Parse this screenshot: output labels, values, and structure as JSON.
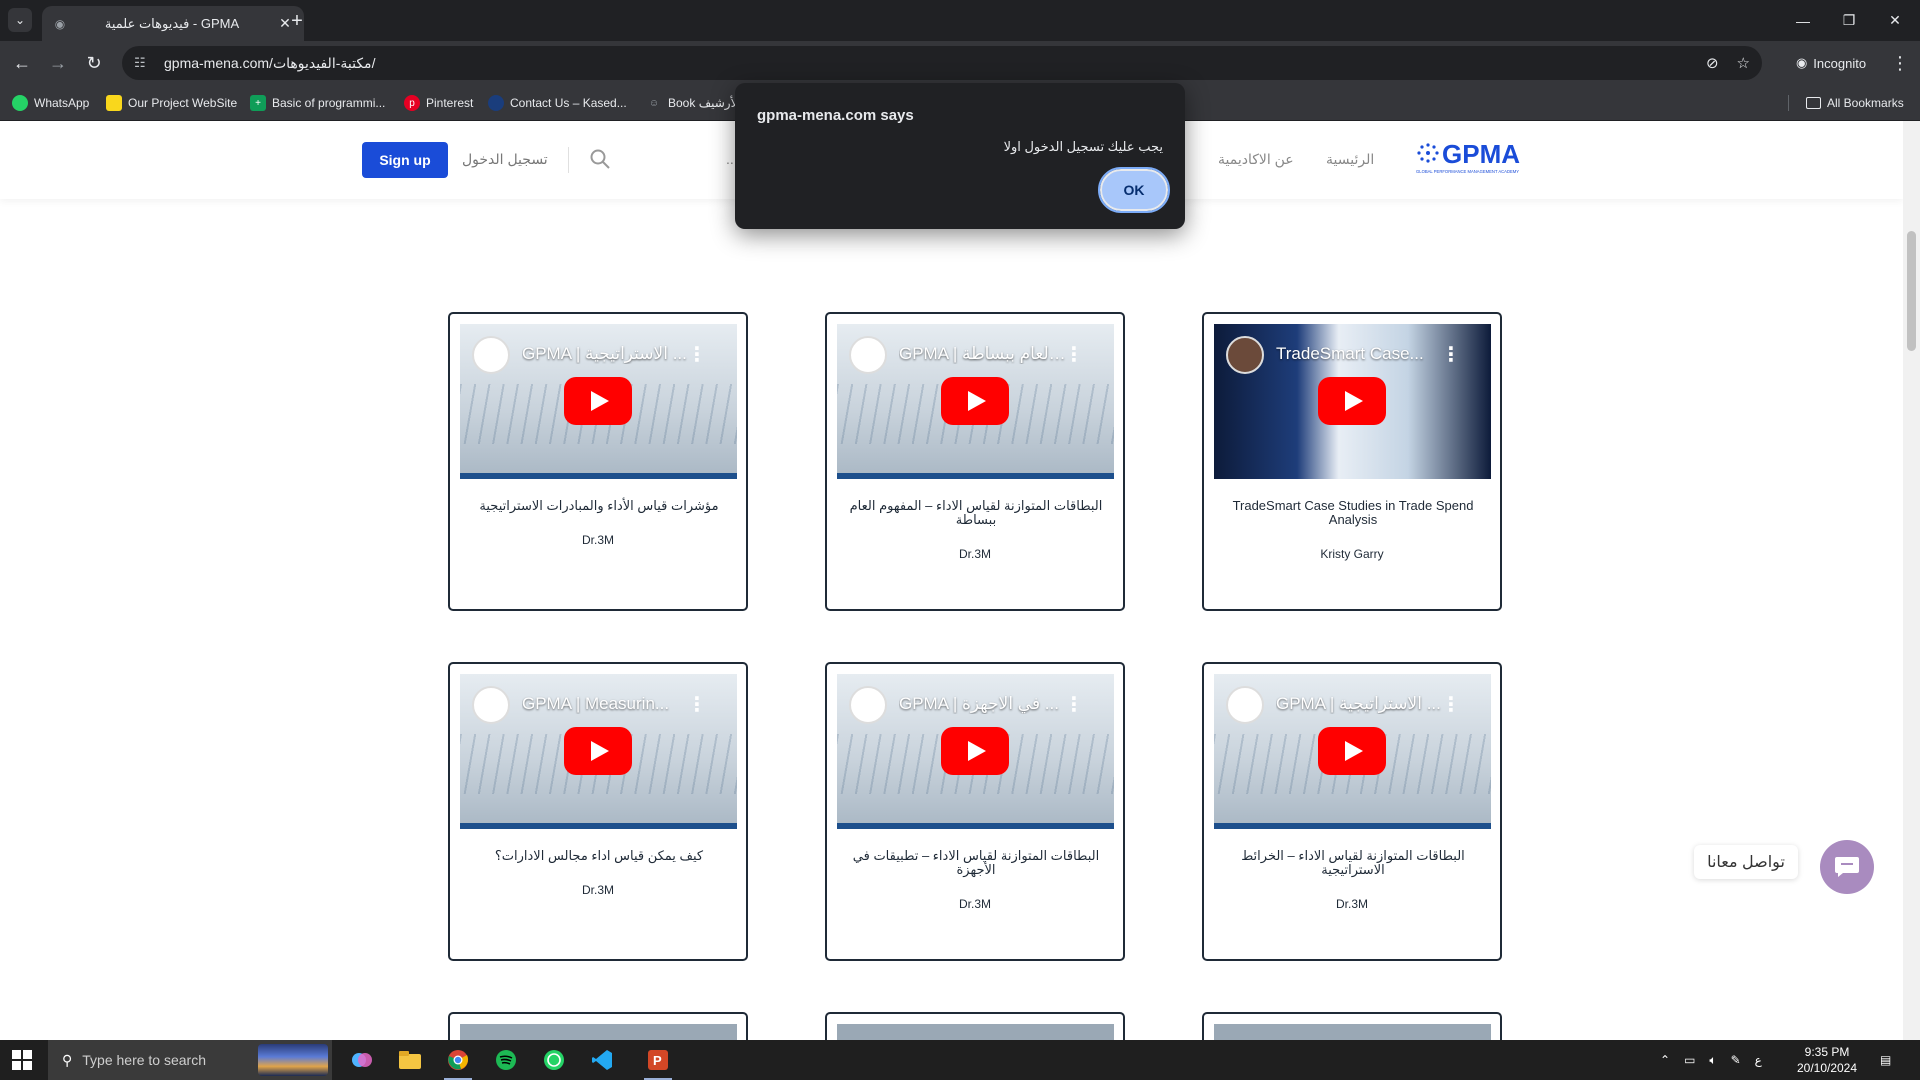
{
  "browser": {
    "tab_title": "فيديوهات علمية - GPMA",
    "url": "gpma-mena.com/مكتبة-الفيديوهات/",
    "incognito_label": "Incognito",
    "bookmarks": [
      {
        "label": "WhatsApp",
        "icon": "whatsapp-icon",
        "color": "#25d366"
      },
      {
        "label": "Our Project WebSite",
        "icon": "folder-icon",
        "color": "#f9d71c"
      },
      {
        "label": "Basic of programmi...",
        "icon": "sheets-icon",
        "color": "#0f9d58"
      },
      {
        "label": "Pinterest",
        "icon": "pinterest-icon",
        "color": "#e60023"
      },
      {
        "label": "Contact Us – Kased...",
        "icon": "site-icon",
        "color": "#1a3d7c"
      },
      {
        "label": "Book الأرشيف",
        "icon": "person-icon",
        "color": "#9aa0a6"
      }
    ],
    "all_bookmarks": "All Bookmarks"
  },
  "site": {
    "signup": "Sign up",
    "login": "تسجيل الدخول",
    "nav": [
      "الرئيسية",
      "عن الاكاديمية"
    ],
    "more": "...",
    "logo_text": "GPMA",
    "logo_sub": "GLOBAL PERFORMANCE MANAGEMENT ACADEMY"
  },
  "videos": [
    {
      "thumb_title": "GPMA | الاستراتيجية ...",
      "title": "مؤشرات قياس الأداء والمبادرات الاستراتيجية",
      "author": "Dr.3M",
      "style": "gpma"
    },
    {
      "thumb_title": "GPMA | العام ببساطة ...",
      "title": "البطاقات المتوازنة لقياس الاداء – المفهوم العام ببساطة",
      "author": "Dr.3M",
      "style": "gpma"
    },
    {
      "thumb_title": "TradeSmart Case...",
      "title": "TradeSmart Case Studies in Trade Spend Analysis",
      "author": "Kristy Garry",
      "style": "tradesmart"
    },
    {
      "thumb_title": "GPMA | Measurin...",
      "title": "كيف يمكن قياس اداء مجالس الادارات؟",
      "author": "Dr.3M",
      "style": "gpma"
    },
    {
      "thumb_title": "GPMA | في الاجهزة ...",
      "title": "البطاقات المتوازنة لقياس الاداء – تطبيقات في الأجهزة",
      "author": "Dr.3M",
      "style": "gpma"
    },
    {
      "thumb_title": "GPMA | الاستراتيجية ...",
      "title": "البطاقات المتوازنة لقياس الاداء – الخرائط الاستراتيجية",
      "author": "Dr.3M",
      "style": "gpma"
    }
  ],
  "contact_label": "تواصل معانا",
  "dialog": {
    "title": "gpma-mena.com says",
    "message": "يجب عليك تسجيل الدخول اولا",
    "ok": "OK"
  },
  "taskbar": {
    "search_placeholder": "Type here to search",
    "time": "9:35 PM",
    "date": "20/10/2024",
    "lang": "ع"
  }
}
